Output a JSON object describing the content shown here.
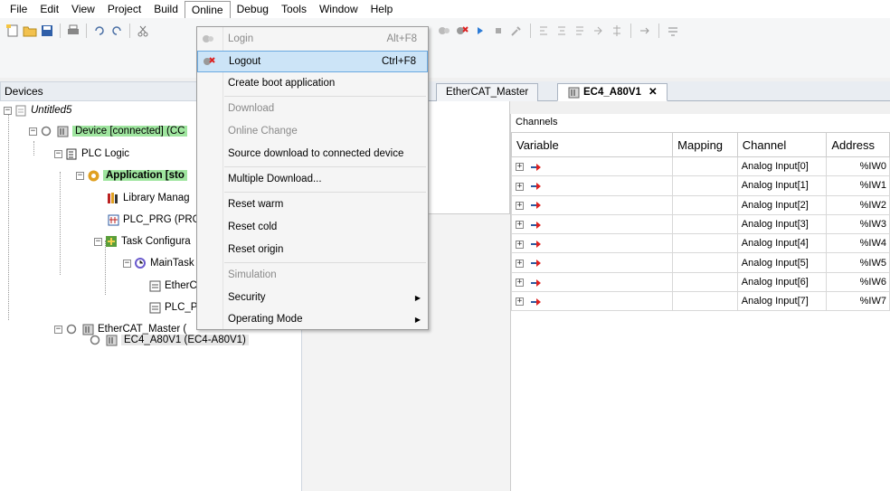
{
  "menubar": {
    "items": [
      "File",
      "Edit",
      "View",
      "Project",
      "Build",
      "Online",
      "Debug",
      "Tools",
      "Window",
      "Help"
    ]
  },
  "online_menu": {
    "items": [
      {
        "label": "Login",
        "shortcut": "Alt+F8",
        "state": "disabled"
      },
      {
        "label": "Logout",
        "shortcut": "Ctrl+F8",
        "state": "hover"
      },
      {
        "label": "Create boot application",
        "shortcut": "",
        "state": "normal"
      },
      {
        "label": "Download",
        "shortcut": "",
        "state": "disabled"
      },
      {
        "label": "Online Change",
        "shortcut": "",
        "state": "disabled"
      },
      {
        "label": "Source download to connected device",
        "shortcut": "",
        "state": "normal"
      },
      {
        "label": "Multiple Download...",
        "shortcut": "",
        "state": "normal"
      },
      {
        "label": "Reset warm",
        "shortcut": "",
        "state": "normal"
      },
      {
        "label": "Reset cold",
        "shortcut": "",
        "state": "normal"
      },
      {
        "label": "Reset origin",
        "shortcut": "",
        "state": "normal"
      },
      {
        "label": "Simulation",
        "shortcut": "",
        "state": "disabled"
      },
      {
        "label": "Security",
        "shortcut": "",
        "state": "submenu"
      },
      {
        "label": "Operating Mode",
        "shortcut": "",
        "state": "submenu"
      }
    ]
  },
  "devices": {
    "header": "Devices",
    "tree": {
      "project": "Untitled5",
      "device": "Device [connected] (CC",
      "plc_logic": "PLC Logic",
      "application": "Application [sto",
      "library_manager": "Library Manag",
      "plc_prg": "PLC_PRG (PRG",
      "task_config": "Task Configura",
      "main_task": "MainTask",
      "ethercat_call": "EtherC",
      "plc_prg_call": "PLC_P",
      "ethercat_master": "EtherCAT_Master (",
      "ec4": "EC4_A80V1 (EC4-A80V1)"
    }
  },
  "editor": {
    "tabs": [
      {
        "label": "EtherCAT_Master",
        "active": false
      },
      {
        "label": "EC4_A80V1",
        "active": true
      }
    ],
    "channels": {
      "title": "Channels",
      "columns": [
        "Variable",
        "Mapping",
        "Channel",
        "Address"
      ],
      "rows": [
        {
          "channel": "Analog Input[0]",
          "address": "%IW0"
        },
        {
          "channel": "Analog Input[1]",
          "address": "%IW1"
        },
        {
          "channel": "Analog Input[2]",
          "address": "%IW2"
        },
        {
          "channel": "Analog Input[3]",
          "address": "%IW3"
        },
        {
          "channel": "Analog Input[4]",
          "address": "%IW4"
        },
        {
          "channel": "Analog Input[5]",
          "address": "%IW5"
        },
        {
          "channel": "Analog Input[6]",
          "address": "%IW6"
        },
        {
          "channel": "Analog Input[7]",
          "address": "%IW7"
        }
      ]
    }
  },
  "colors": {
    "connected_highlight": "#9fe59f",
    "menu_hover": "#cce4f7"
  }
}
